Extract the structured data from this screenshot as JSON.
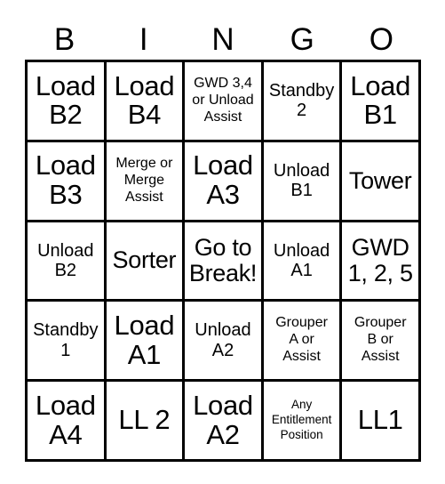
{
  "card": {
    "header": {
      "letters": [
        "B",
        "I",
        "N",
        "G",
        "O"
      ]
    },
    "grid": {
      "rows": 5,
      "columns": 5,
      "border_color": "#000000",
      "background_color": "#ffffff",
      "text_color": "#000000",
      "cells": [
        {
          "text": "Load\nB2",
          "size": "xl"
        },
        {
          "text": "Load\nB4",
          "size": "xl"
        },
        {
          "text": "GWD 3,4\nor Unload\nAssist",
          "size": "sm"
        },
        {
          "text": "Standby\n2",
          "size": "md"
        },
        {
          "text": "Load\nB1",
          "size": "xl"
        },
        {
          "text": "Load\nB3",
          "size": "xl"
        },
        {
          "text": "Merge or\nMerge\nAssist",
          "size": "sm"
        },
        {
          "text": "Load\nA3",
          "size": "xl"
        },
        {
          "text": "Unload\nB1",
          "size": "md"
        },
        {
          "text": "Tower",
          "size": "lg"
        },
        {
          "text": "Unload\nB2",
          "size": "md"
        },
        {
          "text": "Sorter",
          "size": "lg"
        },
        {
          "text": "Go to\nBreak!",
          "size": "lg"
        },
        {
          "text": "Unload\nA1",
          "size": "md"
        },
        {
          "text": "GWD\n1, 2, 5",
          "size": "lg"
        },
        {
          "text": "Standby\n1",
          "size": "md"
        },
        {
          "text": "Load\nA1",
          "size": "xl"
        },
        {
          "text": "Unload\nA2",
          "size": "md"
        },
        {
          "text": "Grouper\nA or\nAssist",
          "size": "sm"
        },
        {
          "text": "Grouper\nB or\nAssist",
          "size": "sm"
        },
        {
          "text": "Load\nA4",
          "size": "xl"
        },
        {
          "text": "LL 2",
          "size": "xl"
        },
        {
          "text": "Load\nA2",
          "size": "xl"
        },
        {
          "text": "Any\nEntitlement\nPosition",
          "size": "xs"
        },
        {
          "text": "LL1",
          "size": "xl"
        }
      ]
    }
  }
}
